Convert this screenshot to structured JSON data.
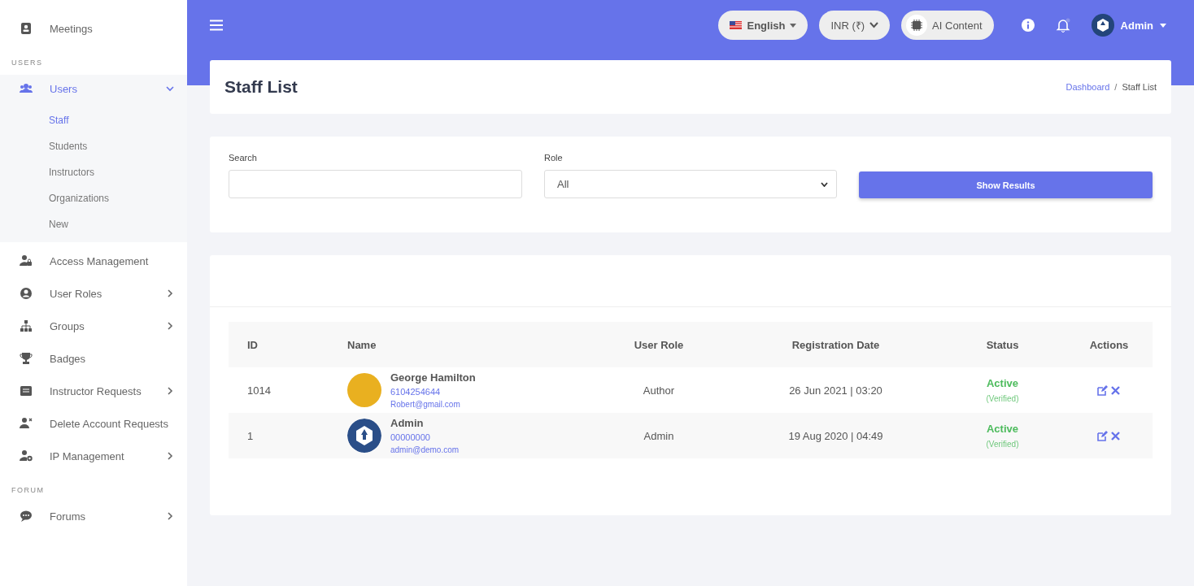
{
  "sidebar": {
    "items": [
      {
        "kind": "item",
        "label": "Meetings",
        "has_submenu": false,
        "expanded": false
      },
      {
        "kind": "section",
        "label": "USERS"
      },
      {
        "kind": "item",
        "label": "Users",
        "has_submenu": true,
        "expanded": true,
        "children": [
          {
            "label": "Staff",
            "selected": true
          },
          {
            "label": "Students",
            "selected": false
          },
          {
            "label": "Instructors",
            "selected": false
          },
          {
            "label": "Organizations",
            "selected": false
          },
          {
            "label": "New",
            "selected": false
          }
        ]
      },
      {
        "kind": "item",
        "label": "Access Management",
        "has_submenu": false,
        "expanded": false
      },
      {
        "kind": "item",
        "label": "User Roles",
        "has_submenu": true,
        "expanded": false
      },
      {
        "kind": "item",
        "label": "Groups",
        "has_submenu": true,
        "expanded": false
      },
      {
        "kind": "item",
        "label": "Badges",
        "has_submenu": false,
        "expanded": false
      },
      {
        "kind": "item",
        "label": "Instructor Requests",
        "has_submenu": true,
        "expanded": false
      },
      {
        "kind": "item",
        "label": "Delete Account Requests",
        "has_submenu": false,
        "expanded": false
      },
      {
        "kind": "item",
        "label": "IP Management",
        "has_submenu": true,
        "expanded": false
      },
      {
        "kind": "section",
        "label": "FORUM"
      },
      {
        "kind": "item",
        "label": "Forums",
        "has_submenu": true,
        "expanded": false
      }
    ]
  },
  "topbar": {
    "language": "English",
    "currency": "INR (₹)",
    "ai_button": "AI Content",
    "notification_dot": true,
    "user": "Admin"
  },
  "page": {
    "title": "Staff List",
    "breadcrumbs": [
      "Dashboard",
      "Staff List"
    ],
    "breadcrumb_separator": "/"
  },
  "filters": {
    "search_label": "Search",
    "role_label": "Role",
    "role_value": "All",
    "button": "Show Results"
  },
  "table": {
    "columns": [
      "ID",
      "Name",
      "User Role",
      "Registration Date",
      "Status",
      "Actions"
    ],
    "rows": [
      {
        "id": "1014",
        "kind": "photo",
        "name": "George Hamilton",
        "phone": "6104254644",
        "email": "Robert@gmail.com",
        "role": "Author",
        "date": "26 Jun 2021 | 03:20",
        "status": "Active",
        "status_note": "(Verified)",
        "color": "#4cbb5c"
      },
      {
        "id": "1",
        "kind": "logo",
        "name": "Admin",
        "phone": "00000000",
        "email": "admin@demo.com",
        "role": "Admin",
        "date": "19 Aug 2020 | 04:49",
        "status": "Active",
        "status_note": "(Verified)",
        "color": "#4cbb5c"
      }
    ]
  }
}
